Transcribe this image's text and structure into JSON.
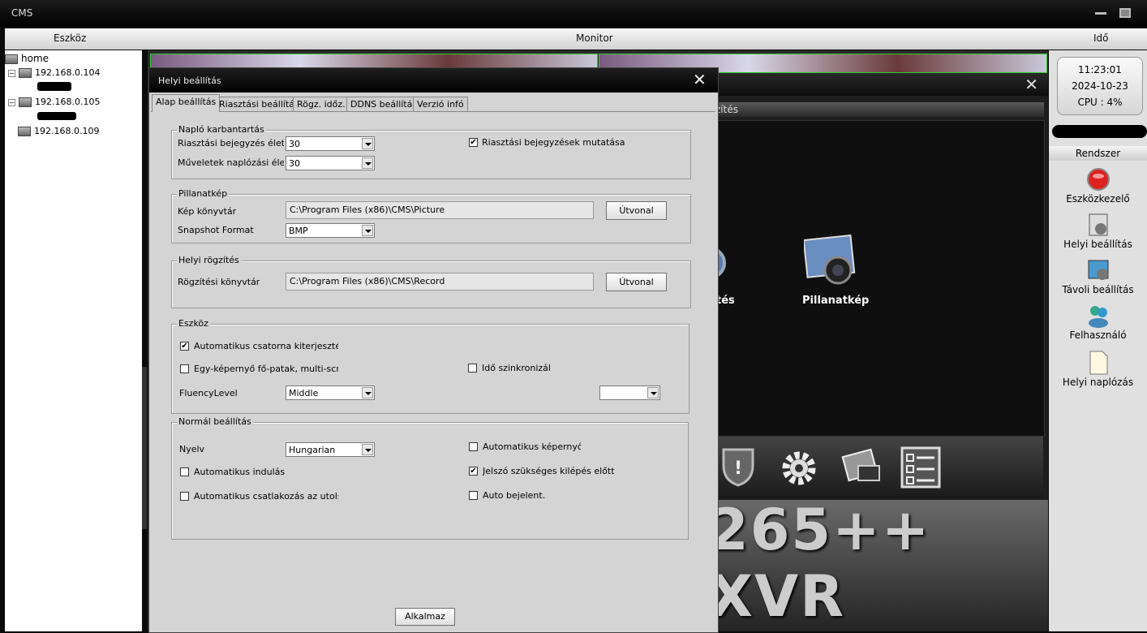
{
  "window": {
    "title": "CMS"
  },
  "header": {
    "left": "Eszköz",
    "center": "Monitor",
    "right": "Idő"
  },
  "tree": {
    "root": "home",
    "devices": [
      "192.168.0.104",
      "192.168.0.105",
      "192.168.0.109"
    ]
  },
  "clock": {
    "time": "11:23:01",
    "date": "2024-10-23",
    "cpu": "CPU : 4%"
  },
  "right_panel": {
    "title": "Rendszer",
    "items": [
      "Eszközkezelő",
      "Helyi beállítás",
      "Távoli beállítás",
      "Felhasználó",
      "Helyi naplózás"
    ]
  },
  "background_window": {
    "strip_text": "zítés",
    "partial_label": "tés",
    "snapshot_label": "Pillanatkép",
    "banner": "265++ XVR"
  },
  "dialog": {
    "title": "Helyi beállítás",
    "tabs": [
      "Alap beállítás",
      "Riasztási beállítás",
      "Rögz. időz.",
      "DDNS beállítás",
      "Verzió infó"
    ],
    "log": {
      "title": "Napló karbantartás",
      "alarm_life_label": "Riasztási bejegyzés élettart",
      "alarm_life_value": "30",
      "op_life_label": "Műveletek naplózási élettar",
      "op_life_value": "30",
      "show_alarm_label": "Riasztási bejegyzések mutatása",
      "show_alarm_checked": true
    },
    "snapshot": {
      "title": "Pillanatkép",
      "dir_label": "Kép könyvtár",
      "dir_value": "C:\\Program Files (x86)\\CMS\\Picture",
      "path_button": "Útvonal",
      "format_label": "Snapshot Format",
      "format_value": "BMP"
    },
    "record": {
      "title": "Helyi rögzítés",
      "dir_label": "Rögzítési könyvtár",
      "dir_value": "C:\\Program Files (x86)\\CMS\\Record",
      "path_button": "Útvonal"
    },
    "device": {
      "title": "Eszköz",
      "auto_expand_label": "Automatikus csatorna kiterjesztés cs",
      "auto_expand_checked": true,
      "single_screen_label": "Egy-képernyő fő-patak, multi-screen",
      "single_screen_checked": false,
      "time_sync_label": "Idő szinkronizálá:",
      "time_sync_checked": false,
      "fluency_label": "FluencyLevel",
      "fluency_value": "Middle",
      "time_sync_value": ""
    },
    "normal": {
      "title": "Normál beállítás",
      "language_label": "Nyelv",
      "language_value": "Hungarian",
      "auto_screen_label": "Automatikus képernyő zá",
      "auto_screen_checked": false,
      "auto_start_label": "Automatikus indulás",
      "auto_start_checked": false,
      "password_exit_label": "Jelszó szükséges kilépés előtt",
      "password_exit_checked": true,
      "auto_connect_label": "Automatikus csatlakozás az utolsó me",
      "auto_connect_checked": false,
      "auto_login_label": "Auto bejelent.",
      "auto_login_checked": false
    },
    "apply_button": "Alkalmaz"
  }
}
